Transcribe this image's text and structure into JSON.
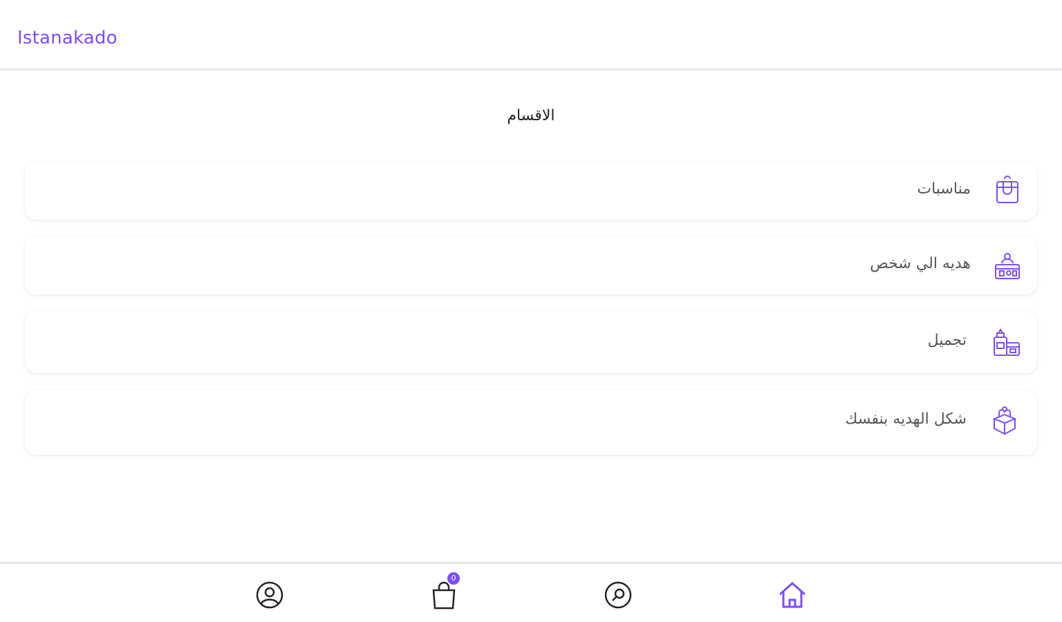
{
  "header": {
    "brand": "Istanakado"
  },
  "main": {
    "title": "الاقسام",
    "categories": [
      {
        "label": "مناسبات",
        "icon": "gift-bag-icon"
      },
      {
        "label": "هديه الي شخص",
        "icon": "gift-person-icon"
      },
      {
        "label": "تجميل",
        "icon": "beauty-icon"
      },
      {
        "label": "شكل الهديه بنفسك",
        "icon": "custom-gift-box-icon"
      }
    ]
  },
  "bottom_nav": {
    "items": [
      {
        "name": "profile",
        "icon": "user-circle-icon"
      },
      {
        "name": "cart",
        "icon": "shopping-bag-icon",
        "badge": "0"
      },
      {
        "name": "search",
        "icon": "search-icon"
      },
      {
        "name": "home",
        "icon": "home-icon",
        "active": true
      }
    ]
  },
  "colors": {
    "accent": "#7c4dff",
    "text_dark": "#222222",
    "text_muted": "#555555",
    "border": "#e6e6e6"
  }
}
